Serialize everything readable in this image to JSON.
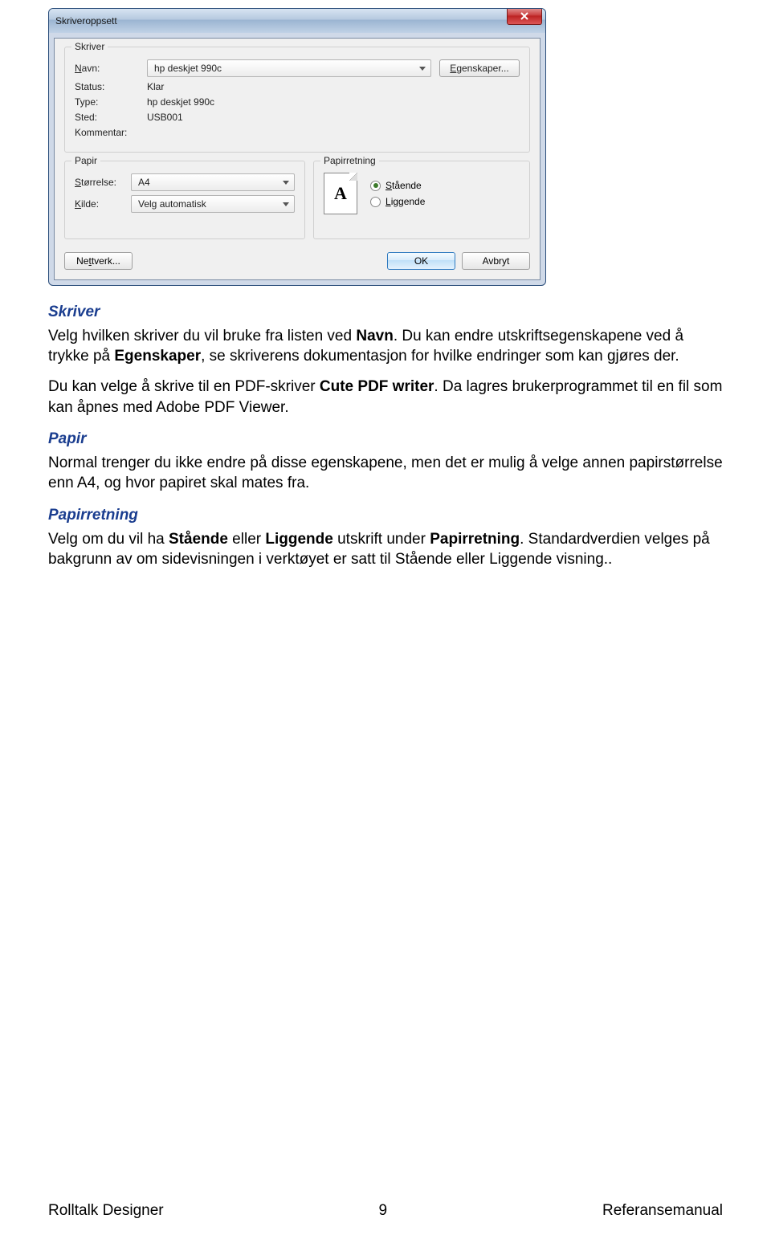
{
  "dialog": {
    "title": "Skriveroppsett",
    "close": "X",
    "printer": {
      "legend": "Skriver",
      "name_label": "Navn:",
      "name_value": "hp deskjet 990c",
      "properties_btn": "Egenskaper...",
      "status_label": "Status:",
      "status_value": "Klar",
      "type_label": "Type:",
      "type_value": "hp deskjet 990c",
      "where_label": "Sted:",
      "where_value": "USB001",
      "comment_label": "Kommentar:",
      "comment_value": ""
    },
    "paper": {
      "legend": "Papir",
      "size_label": "Størrelse:",
      "size_value": "A4",
      "source_label": "Kilde:",
      "source_value": "Velg automatisk"
    },
    "orientation": {
      "legend": "Papirretning",
      "icon_text": "A",
      "portrait": "Stående",
      "landscape": "Liggende"
    },
    "buttons": {
      "network": "Nettverk...",
      "ok": "OK",
      "cancel": "Avbryt"
    }
  },
  "body": {
    "h1": "Skriver",
    "p1a": "Velg hvilken skriver du vil bruke fra listen ved ",
    "p1b": "Navn",
    "p1c": ". Du kan endre utskriftsegenskapene ved å trykke på ",
    "p1d": "Egenskaper",
    "p1e": ", se skriverens dokumentasjon for hvilke endringer som kan gjøres der.",
    "p2a": "Du kan velge å skrive til en PDF-skriver ",
    "p2b": "Cute PDF writer",
    "p2c": ". Da lagres brukerprogrammet til en fil som kan åpnes med Adobe PDF Viewer.",
    "h2": "Papir",
    "p3": "Normal trenger du ikke endre på disse egenskapene, men det er mulig å velge annen papirstørrelse enn A4, og hvor papiret skal mates fra.",
    "h3": "Papirretning",
    "p4a": "Velg om du vil ha ",
    "p4b": "Stående",
    "p4c": " eller ",
    "p4d": "Liggende",
    "p4e": " utskrift under ",
    "p4f": "Papirretning",
    "p4g": ". Standardverdien velges på bakgrunn av om sidevisningen i verktøyet er satt til Stående eller Liggende visning.."
  },
  "footer": {
    "left": "Rolltalk Designer",
    "center": "9",
    "right": "Referansemanual"
  }
}
